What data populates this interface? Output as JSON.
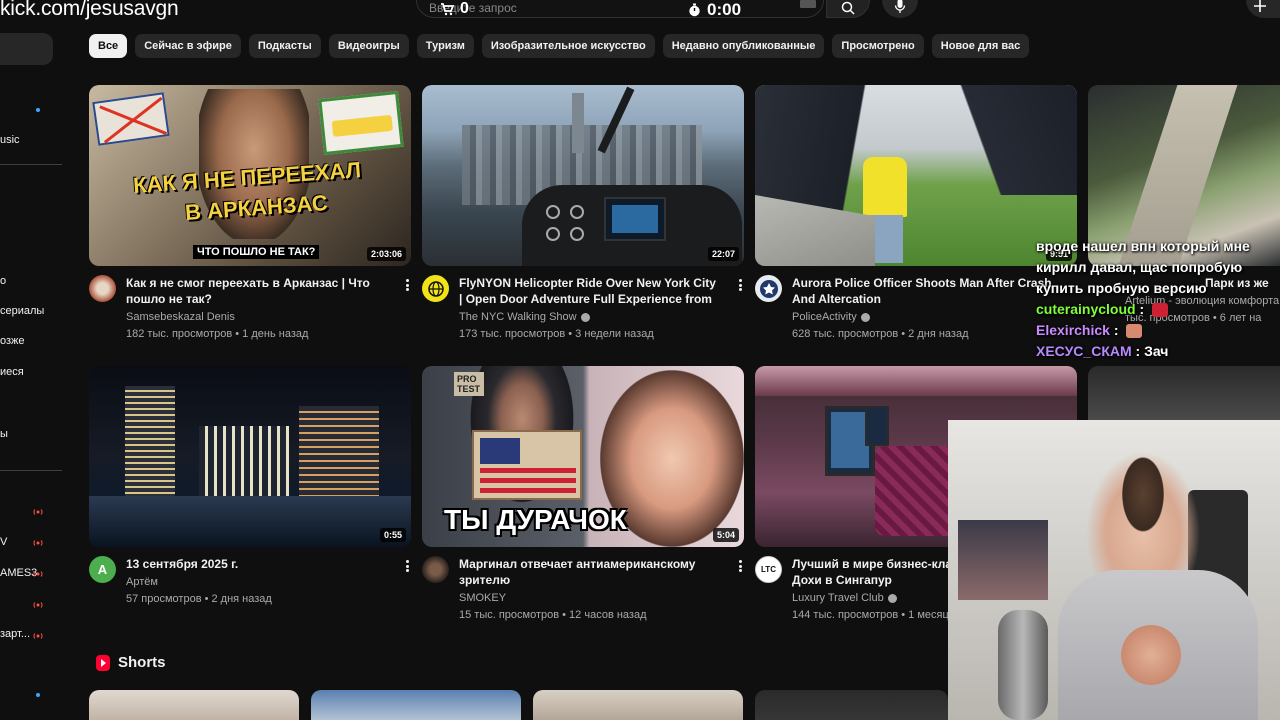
{
  "overlay": {
    "url": "kick.com/jesusavgn"
  },
  "header": {
    "search_placeholder": "Введите запрос",
    "counter": "0",
    "timer": "0:00"
  },
  "sidebar": {
    "items": [
      {
        "label": "usic"
      },
      {
        "label": "о"
      },
      {
        "label": "сериалы"
      },
      {
        "label": "озже"
      },
      {
        "label": "иеся"
      },
      {
        "label": "ы"
      }
    ],
    "live": [
      {
        "label": "V"
      },
      {
        "label": "AMES3"
      },
      {
        "label": ""
      },
      {
        "label": "зарт..."
      }
    ]
  },
  "chips": [
    "Все",
    "Сейчас в эфире",
    "Подкасты",
    "Видеоигры",
    "Туризм",
    "Изобразительное искусство",
    "Недавно опубликованные",
    "Просмотрено",
    "Новое для вас"
  ],
  "videos": [
    {
      "title": "Как я не смог переехать в Арканзас | Что пошло не так?",
      "channel": "Samsebeskazal Denis",
      "stats": "182 тыс. просмотров • 1 день назад",
      "duration": "2:03:06",
      "thumb_text_1": "КАК Я НЕ ПЕРЕЕХАЛ",
      "thumb_text_2": "В АРКАНЗАС",
      "thumb_text_3": "ЧТО ПОШЛО НЕ ТАК?",
      "verified": false
    },
    {
      "title": "FlyNYON Helicopter Ride Over New York City | Open Door Adventure Full Experience from Co-...",
      "channel": "The NYC Walking Show",
      "stats": "173 тыс. просмотров • 3 недели назад",
      "duration": "22:07",
      "verified": true
    },
    {
      "title": "Aurora Police Officer Shoots Man After Crash And Altercation",
      "channel": "PoliceActivity",
      "stats": "628 тыс. просмотров • 2 дня назад",
      "duration": "9:51",
      "verified": true
    },
    {
      "title": "13 сентября 2025 г.",
      "channel": "Артём",
      "stats": "57 просмотров • 2 дня назад",
      "duration": "0:55",
      "avatar_letter": "A",
      "verified": false
    },
    {
      "title": "Маргинал отвечает антиамериканскому зрителю",
      "channel": "SMOKEY",
      "stats": "15 тыс. просмотров • 12 часов назад",
      "duration": "5:04",
      "thumb_text_1": "ТЫ ДУРАЧОК",
      "thumb_text_2": "PRO TEST",
      "verified": false
    },
    {
      "title": "Лучший в мире бизнес-класс Qsuite | Из Дохи в Сингапур",
      "channel": "Luxury Travel Club",
      "stats": "144 тыс. просмотров • 1 месяц",
      "avatar_letter": "LTC",
      "verified": true
    }
  ],
  "partial_video": {
    "title": "Парк из же",
    "channel": "Artelium - эволюция комфорта",
    "stats": "тыс. просмотров • 6 лет на"
  },
  "shorts": {
    "label": "Shorts"
  },
  "chat": [
    {
      "user": "",
      "text": "вроде нашел впн который мне",
      "color": "#ffffff"
    },
    {
      "user": "",
      "text": "кирилл давал, щас попробую",
      "color": "#ffffff"
    },
    {
      "user": "",
      "text": "купить пробную версию",
      "color": "#ffffff"
    },
    {
      "user": "cuterainycloud",
      "text": ":",
      "color": "#7fff3a"
    },
    {
      "user": "Elexirchick",
      "text": ":",
      "color": "#c98bff"
    },
    {
      "user": "ХЕСУС_СКАМ",
      "text": ": Зач",
      "color": "#b68aff"
    }
  ]
}
